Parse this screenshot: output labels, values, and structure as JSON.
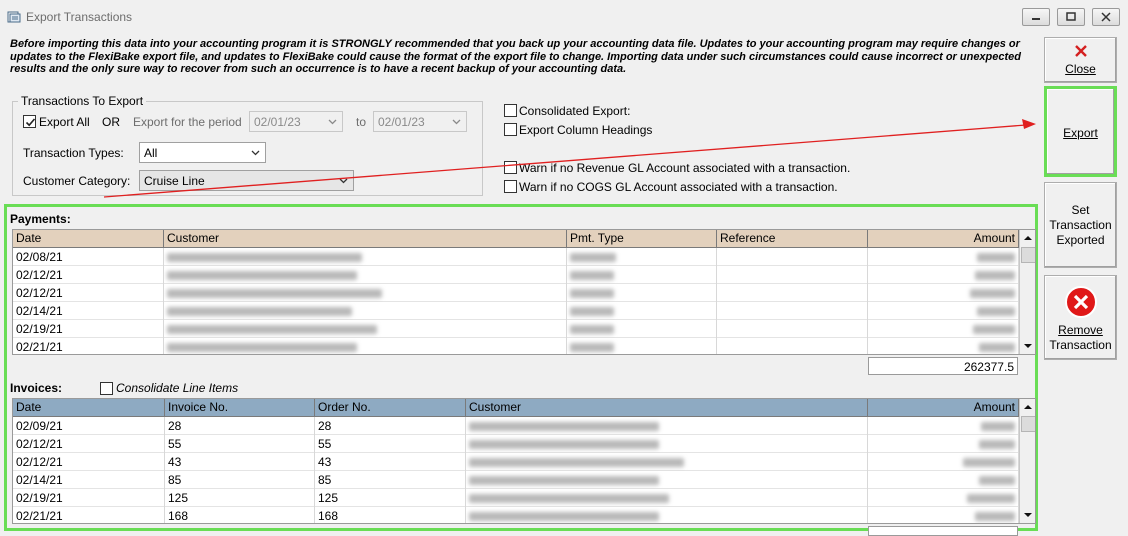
{
  "window": {
    "title": "Export Transactions"
  },
  "warning_text": "Before importing this data into your accounting program it is STRONGLY recommended that you back up your accounting data file. Updates to your accounting program may require changes or updates to the FlexiBake export file, and updates to FlexiBake could cause the format of the export file to change. Importing data under such circumstances could cause incorrect or unexpected results and the only sure way to recover from such an occurrence is to have a recent backup of your accounting data.",
  "filters": {
    "group_title": "Transactions To Export",
    "export_all_label": "Export All",
    "export_all_checked": true,
    "or_label": "OR",
    "period_label": "Export for the period",
    "period_from": "02/01/23",
    "to_label": "to",
    "period_to": "02/01/23",
    "transaction_types_label": "Transaction Types:",
    "transaction_types_value": "All",
    "customer_category_label": "Customer Category:",
    "customer_category_value": "Cruise Line"
  },
  "options": {
    "consolidated_export": "Consolidated Export:",
    "export_column_headings": "Export Column Headings",
    "warn_revenue": "Warn if no Revenue GL Account associated with a transaction.",
    "warn_cogs": "Warn if no COGS GL Account associated with a transaction."
  },
  "buttons": {
    "close": "Close",
    "export": "Export",
    "set_line1": "Set",
    "set_line2": "Transaction",
    "set_line3": "Exported",
    "remove_line1": "Remove",
    "remove_line2": "Transaction"
  },
  "payments": {
    "label": "Payments:",
    "columns": [
      "Date",
      "Customer",
      "Pmt. Type",
      "Reference",
      "Amount"
    ],
    "rows": [
      {
        "date": "02/08/21"
      },
      {
        "date": "02/12/21"
      },
      {
        "date": "02/12/21"
      },
      {
        "date": "02/14/21"
      },
      {
        "date": "02/19/21"
      },
      {
        "date": "02/21/21"
      }
    ],
    "total": "262377.5"
  },
  "invoices": {
    "label": "Invoices:",
    "consolidate_label": "Consolidate Line Items",
    "columns": [
      "Date",
      "Invoice No.",
      "Order No.",
      "Customer",
      "Amount"
    ],
    "rows": [
      {
        "date": "02/09/21",
        "invoice": "28",
        "order": "28"
      },
      {
        "date": "02/12/21",
        "invoice": "55",
        "order": "55"
      },
      {
        "date": "02/12/21",
        "invoice": "43",
        "order": "43"
      },
      {
        "date": "02/14/21",
        "invoice": "85",
        "order": "85"
      },
      {
        "date": "02/19/21",
        "invoice": "125",
        "order": "125"
      },
      {
        "date": "02/21/21",
        "invoice": "168",
        "order": "168"
      }
    ]
  },
  "colors": {
    "payments_header": "#e3d1bd",
    "invoices_header": "#8eaac2",
    "highlight": "#69dd55",
    "arrow": "#e02020",
    "remove_icon": "#e01818"
  }
}
